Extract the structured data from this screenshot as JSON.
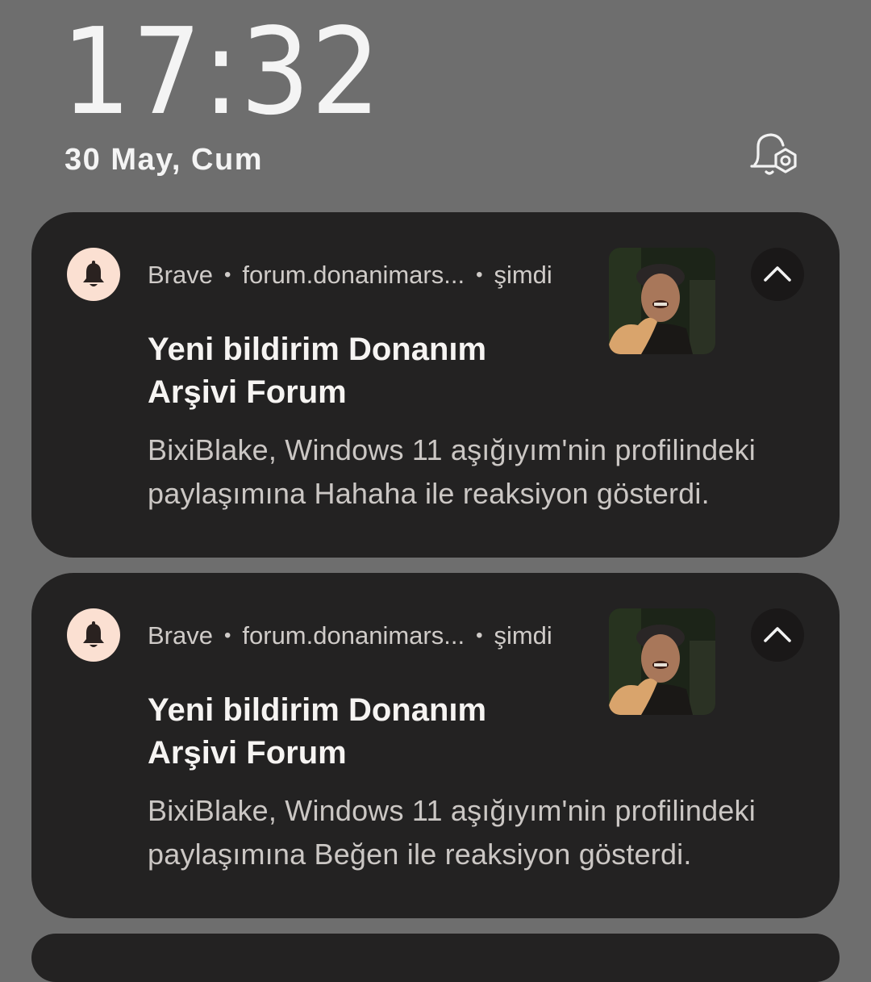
{
  "lockscreen": {
    "time": "17:32",
    "date": "30 May, Cum",
    "notification_settings_icon": "bell-gear-icon"
  },
  "notifications": [
    {
      "app": "Brave",
      "source": "forum.donanimars...",
      "time": "şimdi",
      "app_icon": "bell-icon",
      "thumbnail": "user-avatar-photo",
      "expand_icon": "chevron-up-icon",
      "title": "Yeni bildirim Donanım Arşivi Forum",
      "body": "BixiBlake, Windows 11 aşığıyım'nin profilindeki paylaşımına Hahaha ile reaksiyon gösterdi."
    },
    {
      "app": "Brave",
      "source": "forum.donanimars...",
      "time": "şimdi",
      "app_icon": "bell-icon",
      "thumbnail": "user-avatar-photo",
      "expand_icon": "chevron-up-icon",
      "title": "Yeni bildirim Donanım Arşivi Forum",
      "body": "BixiBlake, Windows 11 aşığıyım'nin profilindeki paylaşımına Beğen ile reaksiyon gösterdi."
    }
  ],
  "colors": {
    "background": "#6e6e6e",
    "card": "#232222",
    "app_icon_bg": "#fbe0d2",
    "text_primary": "#f6f4f2",
    "text_secondary": "#cbc7c4"
  }
}
